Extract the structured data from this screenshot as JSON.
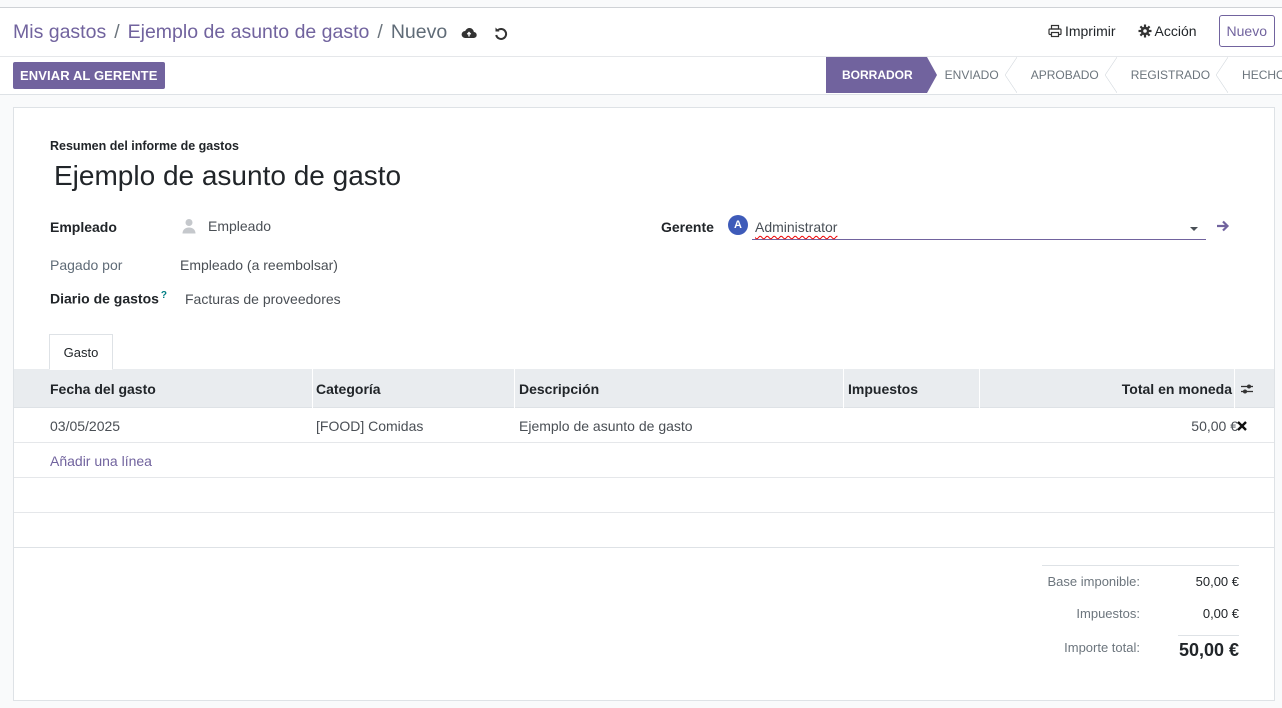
{
  "breadcrumb": {
    "root": "Mis gastos",
    "record": "Ejemplo de asunto de gasto",
    "current": "Nuevo",
    "separator": "/"
  },
  "header_actions": {
    "print": "Imprimir",
    "action": "Acción",
    "new": "Nuevo"
  },
  "statusbar": {
    "primary_button": "ENVIAR AL GERENTE",
    "stages": [
      "BORRADOR",
      "ENVIADO",
      "APROBADO",
      "REGISTRADO",
      "HECHO"
    ],
    "active_stage": "BORRADOR"
  },
  "form": {
    "subtitle": "Resumen del informe de gastos",
    "title": "Ejemplo de asunto de gasto",
    "employee_label": "Empleado",
    "employee_value": "Empleado",
    "paid_by_label": "Pagado por",
    "paid_by_value": "Empleado (a reembolsar)",
    "journal_label": "Diario de gastos",
    "journal_help": "?",
    "journal_value": "Facturas de proveedores",
    "manager_label": "Gerente",
    "manager_avatar": "A",
    "manager_value": "Administrator"
  },
  "tabs": {
    "expense": "Gasto"
  },
  "table": {
    "columns": [
      "Fecha del gasto",
      "Categoría",
      "Descripción",
      "Impuestos",
      "Total en moneda"
    ],
    "rows": [
      {
        "date": "03/05/2025",
        "category": "[FOOD] Comidas",
        "description": "Ejemplo de asunto de gasto",
        "taxes": "",
        "total": "50,00 €"
      }
    ],
    "add_line": "Añadir una línea"
  },
  "totals": {
    "base_label": "Base imponible:",
    "base_value": "50,00 €",
    "tax_label": "Impuestos:",
    "tax_value": "0,00 €",
    "total_label": "Importe total:",
    "total_value": "50,00 €"
  },
  "colors": {
    "brand": "#71639e",
    "avatar": "#3e5bb9"
  }
}
